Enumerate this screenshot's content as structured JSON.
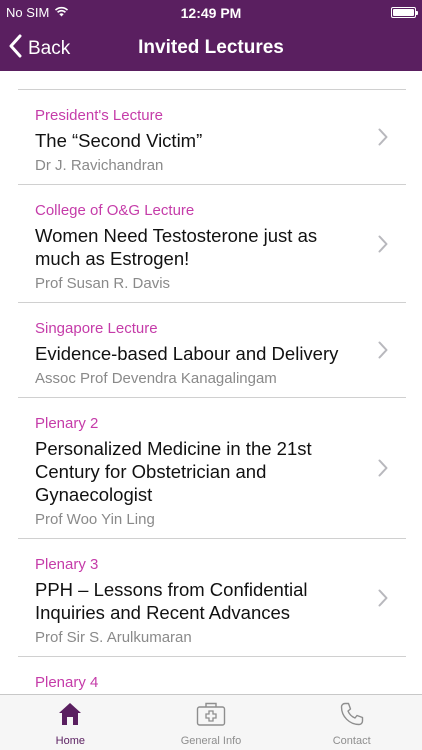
{
  "status_bar": {
    "carrier": "No SIM",
    "time": "12:49 PM"
  },
  "nav": {
    "back_label": "Back",
    "title": "Invited Lectures"
  },
  "lectures": [
    {
      "category": "President's Lecture",
      "title": "The “Second Victim”",
      "speaker": "Dr J. Ravichandran"
    },
    {
      "category": "College of O&G Lecture",
      "title": "Women Need Testosterone just as much as Estrogen!",
      "speaker": "Prof Susan R. Davis"
    },
    {
      "category": "Singapore Lecture",
      "title": "Evidence-based Labour and Delivery",
      "speaker": "Assoc Prof Devendra Kanagalingam"
    },
    {
      "category": "Plenary 2",
      "title": "Personalized Medicine in the 21st Century for Obstetrician and Gynaecologist",
      "speaker": "Prof Woo Yin Ling"
    },
    {
      "category": "Plenary 3",
      "title": "PPH – Lessons from Confidential Inquiries and Recent Advances",
      "speaker": "Prof Sir S. Arulkumaran"
    },
    {
      "category": "Plenary 4",
      "title": "",
      "speaker": ""
    }
  ],
  "tabs": [
    {
      "label": "Home",
      "icon": "home-icon",
      "active": true
    },
    {
      "label": "General Info",
      "icon": "medical-kit-icon",
      "active": false
    },
    {
      "label": "Contact",
      "icon": "phone-icon",
      "active": false
    }
  ],
  "colors": {
    "brand": "#5a1f60",
    "category": "#c53ca9",
    "speaker": "#8a8a8a"
  }
}
